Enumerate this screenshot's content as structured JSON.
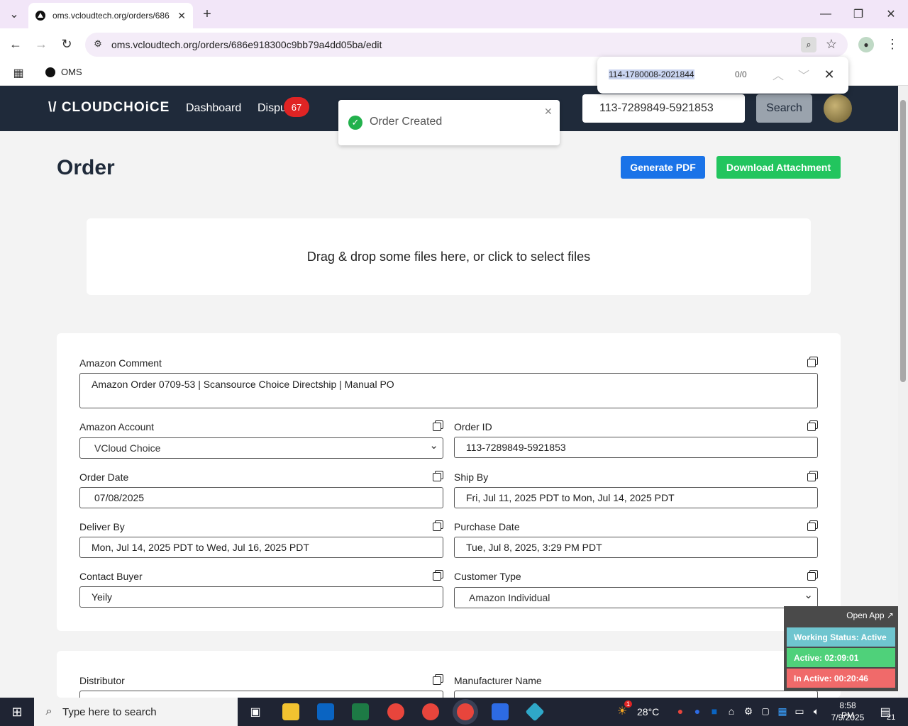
{
  "browser": {
    "tab_title": "oms.vcloudtech.org/orders/686",
    "url": "oms.vcloudtech.org/orders/686e918300c9bb79a4dd05ba/edit",
    "bookmark": "OMS"
  },
  "find": {
    "query": "114-1780008-2021844",
    "count": "0/0"
  },
  "nav": {
    "logo": "\\/ CLOUDCHOiCE",
    "dashboard": "Dashboard",
    "disputes": "Dispu",
    "badge": "67",
    "search_value": "113-7289849-5921853",
    "search_btn": "Search"
  },
  "toast": {
    "message": "Order Created"
  },
  "page": {
    "title": "Order",
    "generate_pdf": "Generate PDF",
    "download": "Download Attachment",
    "dropzone": "Drag & drop some files here, or click to select files"
  },
  "form": {
    "amazon_comment_label": "Amazon Comment",
    "amazon_comment": "Amazon Order 0709-53 | Scansource Choice Directship | Manual PO",
    "amazon_account_label": "Amazon Account",
    "amazon_account": "VCloud Choice",
    "order_id_label": "Order ID",
    "order_id": "113-7289849-5921853",
    "order_date_label": "Order Date",
    "order_date": "07/08/2025",
    "ship_by_label": "Ship By",
    "ship_by": "Fri, Jul 11, 2025 PDT to Mon, Jul 14, 2025 PDT",
    "deliver_by_label": "Deliver By",
    "deliver_by": "Mon, Jul 14, 2025 PDT to Wed, Jul 16, 2025 PDT",
    "purchase_date_label": "Purchase Date",
    "purchase_date": "Tue, Jul 8, 2025, 3:29 PM PDT",
    "contact_buyer_label": "Contact Buyer",
    "contact_buyer": "Yeily",
    "customer_type_label": "Customer Type",
    "customer_type": "Amazon Individual",
    "distributor_label": "Distributor",
    "manufacturer_label": "Manufacturer Name"
  },
  "monitor": {
    "open_app": "Open App ↗",
    "working": "Working Status: Active",
    "active": "Active: 02:09:01",
    "inactive": "In Active: 00:20:46"
  },
  "taskbar": {
    "search": "Type here to search",
    "temp": "28°C",
    "time": "8:58 PM",
    "date": "7/9/2025",
    "notif": "21",
    "weather_badge": "1"
  },
  "colors": {
    "nav": "#1f2a3a",
    "blue": "#1a73e8",
    "green": "#22c55e",
    "teal": "#6fc5cf",
    "active": "#4fd17a",
    "inactive": "#f06a6a"
  }
}
